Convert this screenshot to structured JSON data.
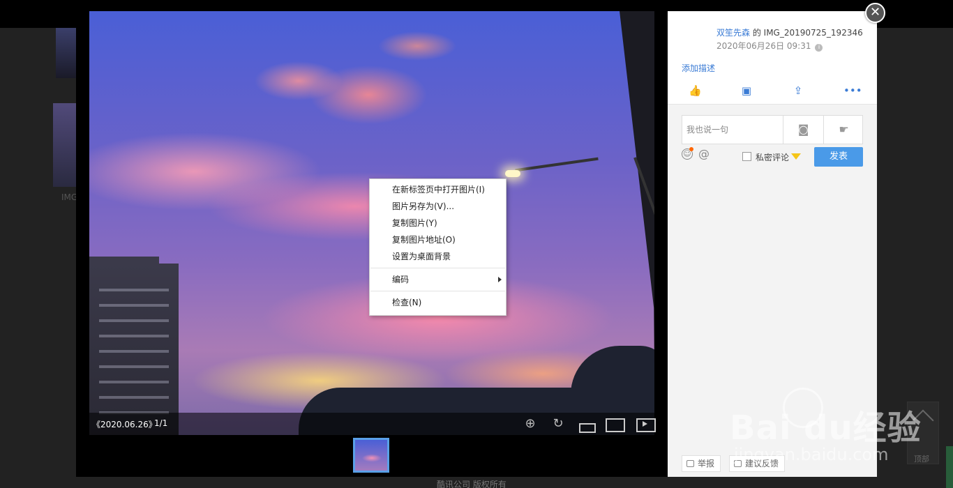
{
  "background_page": {
    "thumb_label": "IMG",
    "footer_text": "酷讯公司 版权所有",
    "back_top_label": "顶部"
  },
  "viewer": {
    "album_date": "《2020.06.26》",
    "page_count": "1/1",
    "tools": [
      "zoom-in-icon",
      "rotate-icon",
      "original-size-icon",
      "fit-screen-icon",
      "slideshow-icon"
    ]
  },
  "context_menu": {
    "items": [
      "在新标签页中打开图片(I)",
      "图片另存为(V)...",
      "复制图片(Y)",
      "复制图片地址(O)",
      "设置为桌面背景",
      "编码",
      "检查(N)"
    ]
  },
  "side": {
    "author": "双笙先森",
    "of": " 的 ",
    "photo_name": "IMG_20190725_192346",
    "date": "2020年06月26日 09:31",
    "add_description": "添加描述",
    "actions": [
      "like-icon",
      "comment-icon",
      "share-icon",
      "more-icon"
    ],
    "comment_placeholder": "我也说一句",
    "private_comment": "私密评论",
    "post_button": "发表",
    "report": "举报",
    "suggest": "建议反馈"
  },
  "watermark": {
    "brand": "Bai  du经验",
    "url": "jingyan.baidu.com"
  },
  "colors": {
    "accent": "#3a7bd5",
    "post_button": "#4a9ae8",
    "thumb_border": "#5aa0e8"
  }
}
